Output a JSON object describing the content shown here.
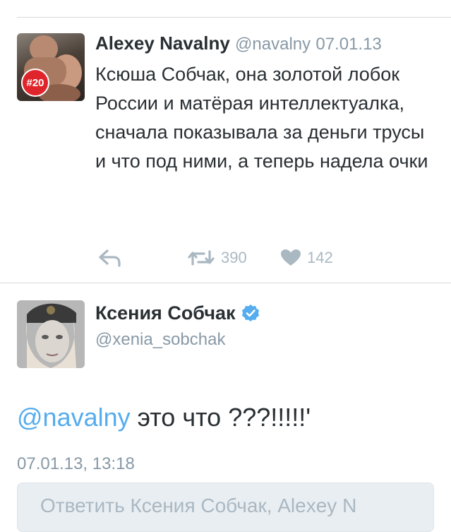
{
  "tweet1": {
    "author_name": "Alexey Navalny",
    "handle": "@navalny",
    "date": "07.01.13",
    "badge": "#20",
    "text": "Ксюша Собчак, она золотой лобок России и матёрая интеллектуалка, сначала показывала за деньги трусы и что под ними, а теперь надела очки",
    "retweet_count": "390",
    "like_count": "142"
  },
  "tweet2": {
    "author_name": "Ксения Собчак",
    "handle": "@xenia_sobchak",
    "mention": "@navalny",
    "text_rest": " это что ???!!!!!'",
    "timestamp": "07.01.13, 13:18"
  },
  "reply_box": {
    "placeholder": "Ответить Ксения Собчак, Alexey N"
  },
  "colors": {
    "link_blue": "#55acee",
    "muted_gray": "#8899a6",
    "icon_gray": "#aab8c2",
    "badge_red": "#e0242b"
  }
}
